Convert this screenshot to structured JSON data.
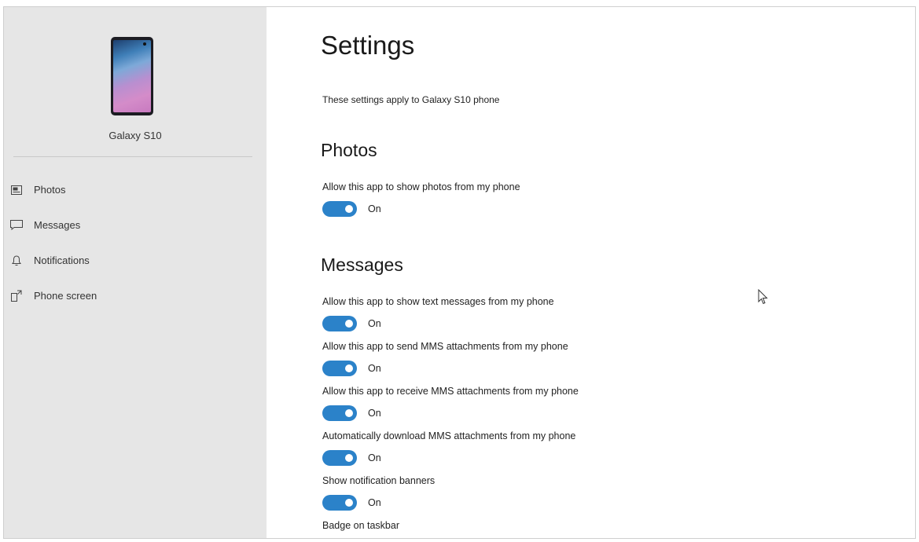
{
  "device": {
    "name": "Galaxy S10"
  },
  "sidebar": {
    "items": [
      {
        "label": "Photos",
        "icon": "photos-icon"
      },
      {
        "label": "Messages",
        "icon": "messages-icon"
      },
      {
        "label": "Notifications",
        "icon": "bell-icon"
      },
      {
        "label": "Phone screen",
        "icon": "phone-screen-icon"
      }
    ]
  },
  "main": {
    "title": "Settings",
    "subtitle": "These settings apply to Galaxy S10 phone",
    "photos": {
      "title": "Photos",
      "settings": [
        {
          "label": "Allow this app to show photos from my phone",
          "state": "On"
        }
      ]
    },
    "messages": {
      "title": "Messages",
      "settings": [
        {
          "label": "Allow this app to show text messages from my phone",
          "state": "On"
        },
        {
          "label": "Allow this app to send MMS attachments from my phone",
          "state": "On"
        },
        {
          "label": "Allow this app to receive MMS attachments from my phone",
          "state": "On"
        },
        {
          "label": "Automatically download MMS attachments from my phone",
          "state": "On"
        },
        {
          "label": "Show notification banners",
          "state": "On"
        },
        {
          "label": "Badge on taskbar",
          "state": ""
        }
      ]
    }
  },
  "colors": {
    "accent": "#2b82c9",
    "sidebar_bg": "#e6e6e6"
  }
}
